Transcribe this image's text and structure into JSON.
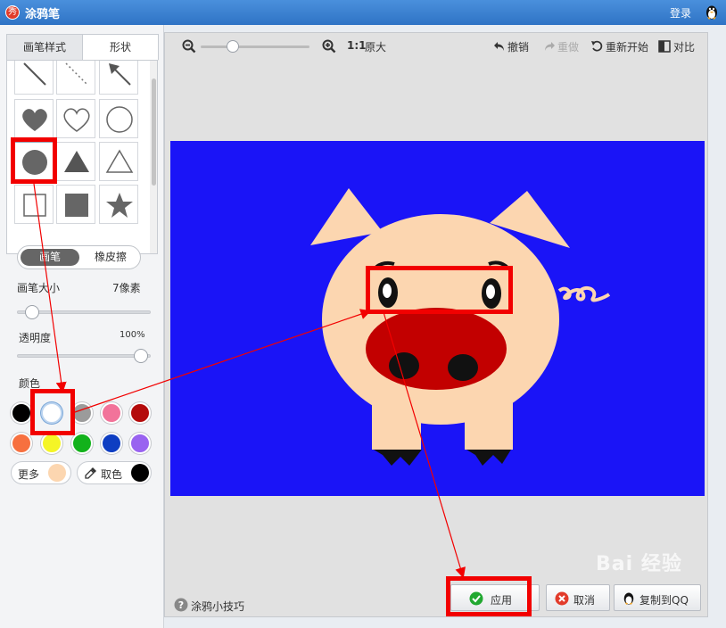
{
  "window": {
    "title": "涂鸦笔",
    "login": "登录",
    "app_icon_char": "秀"
  },
  "left_panel": {
    "tabs": [
      {
        "label": "画笔样式",
        "active": false
      },
      {
        "label": "形状",
        "active": true
      }
    ],
    "shape_grid": [
      "line",
      "dashed-line",
      "arrow",
      "heart-filled",
      "heart-outline",
      "circle-outline",
      "circle-filled",
      "triangle-filled",
      "triangle-outline",
      "square-outline",
      "square-filled",
      "star-filled"
    ],
    "mode_toggle": {
      "on": "画笔",
      "off": "橡皮擦"
    },
    "brush_size": {
      "label": "画笔大小",
      "value": "7像素",
      "level": 0.1
    },
    "opacity": {
      "label": "透明度",
      "value": "100%",
      "level": 1.0
    },
    "color_label": "颜色",
    "swatches": [
      "#000000",
      "#ffffff",
      "#9b9b9b",
      "#f2739a",
      "#b40b0b",
      "#f7703f",
      "#f5f526",
      "#12b21b",
      "#0e3ec2",
      "#9963f0"
    ],
    "selected_swatch": 1,
    "more": {
      "label": "更多",
      "color": "#fcd6b0"
    },
    "pick": {
      "label": "取色",
      "color": "#000000"
    }
  },
  "toolbar": {
    "zoom_label": "1:1",
    "original_label": "原大",
    "zoom_level": 0.3,
    "undo": "撤销",
    "redo": "重做",
    "restart": "重新开始",
    "compare": "对比"
  },
  "footer": {
    "tips": "涂鸦小技巧",
    "apply": "应用",
    "cancel": "取消",
    "copy_to_qq": "复制到QQ"
  },
  "colors": {
    "canvas_bg": "#1a14f7",
    "pig_skin": "#fcd6b0",
    "pig_nose": "#c20000",
    "annotation": "#f20000"
  },
  "watermark": "Bai 经验"
}
